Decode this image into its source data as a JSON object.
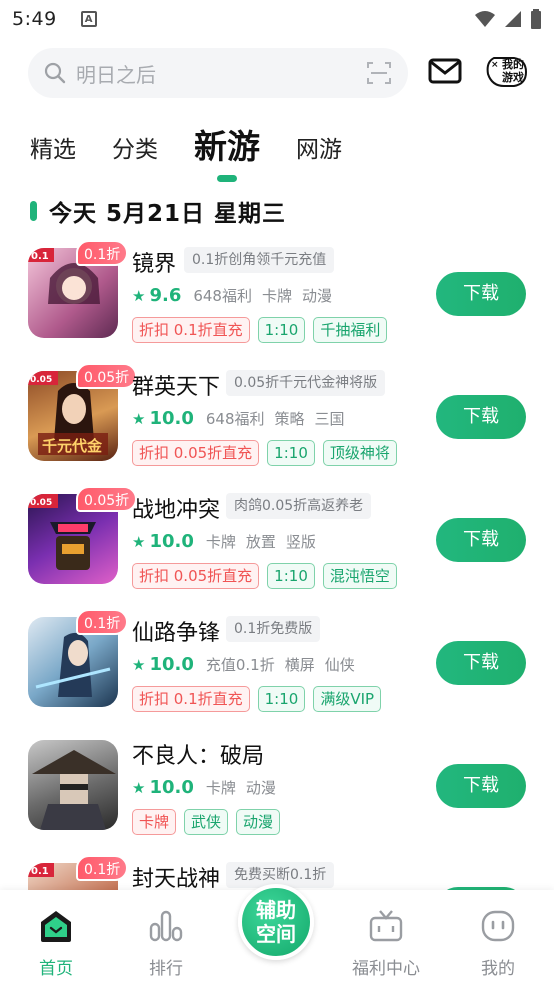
{
  "status_bar": {
    "time": "5:49",
    "notif_glyph": "A"
  },
  "search": {
    "placeholder": "明日之后"
  },
  "header": {
    "my_games_line1": "我的",
    "my_games_line2": "游戏"
  },
  "tabs": [
    {
      "label": "精选",
      "active": false
    },
    {
      "label": "分类",
      "active": false
    },
    {
      "label": "新游",
      "active": true
    },
    {
      "label": "网游",
      "active": false
    }
  ],
  "date_heading": "今天 5月21日 星期三",
  "games": [
    {
      "name": "镜界",
      "discount": "0.1折",
      "slogan": "0.1折创角领千元充值",
      "rating": "9.6",
      "meta": [
        "648福利",
        "卡牌",
        "动漫"
      ],
      "tags": [
        {
          "text": "折扣 0.1折直充",
          "color": "red"
        },
        {
          "text": "1:10",
          "color": "green"
        },
        {
          "text": "千抽福利",
          "color": "green"
        }
      ],
      "button": "下载"
    },
    {
      "name": "群英天下",
      "discount": "0.05折",
      "slogan": "0.05折千元代金神将版",
      "rating": "10.0",
      "meta": [
        "648福利",
        "策略",
        "三国"
      ],
      "tags": [
        {
          "text": "折扣 0.05折直充",
          "color": "red"
        },
        {
          "text": "1:10",
          "color": "green"
        },
        {
          "text": "顶级神将",
          "color": "green"
        }
      ],
      "button": "下载"
    },
    {
      "name": "战地冲突",
      "discount": "0.05折",
      "slogan": "肉鸽0.05折高返养老",
      "rating": "10.0",
      "meta": [
        "卡牌",
        "放置",
        "竖版"
      ],
      "tags": [
        {
          "text": "折扣 0.05折直充",
          "color": "red"
        },
        {
          "text": "1:10",
          "color": "green"
        },
        {
          "text": "混沌悟空",
          "color": "green"
        }
      ],
      "button": "下载"
    },
    {
      "name": "仙路争锋",
      "discount": "0.1折",
      "slogan": "0.1折免费版",
      "rating": "10.0",
      "meta": [
        "充值0.1折",
        "横屏",
        "仙侠"
      ],
      "tags": [
        {
          "text": "折扣 0.1折直充",
          "color": "red"
        },
        {
          "text": "1:10",
          "color": "green"
        },
        {
          "text": "满级VIP",
          "color": "green"
        }
      ],
      "button": "下载"
    },
    {
      "name": "不良人：破局",
      "discount": "",
      "slogan": "",
      "rating": "10.0",
      "meta": [
        "卡牌",
        "动漫"
      ],
      "tags": [
        {
          "text": "卡牌",
          "color": "red"
        },
        {
          "text": "武侠",
          "color": "green"
        },
        {
          "text": "动漫",
          "color": "green"
        }
      ],
      "button": "下载"
    },
    {
      "name": "封天战神",
      "discount": "0.1折",
      "slogan": "免费买断0.1折",
      "rating": "",
      "meta": [],
      "tags": [],
      "button": "下载"
    }
  ],
  "bottom_nav": [
    {
      "label": "首页",
      "icon": "home-icon",
      "active": true
    },
    {
      "label": "排行",
      "icon": "ranking-icon",
      "active": false
    },
    {
      "label": "福利中心",
      "icon": "gift-tv-icon",
      "active": false
    },
    {
      "label": "我的",
      "icon": "profile-face-icon",
      "active": false
    }
  ],
  "center_button": {
    "line1": "辅助",
    "line2": "空间"
  },
  "colors": {
    "accent": "#1fb37a",
    "discount": "#ff5a6a"
  }
}
